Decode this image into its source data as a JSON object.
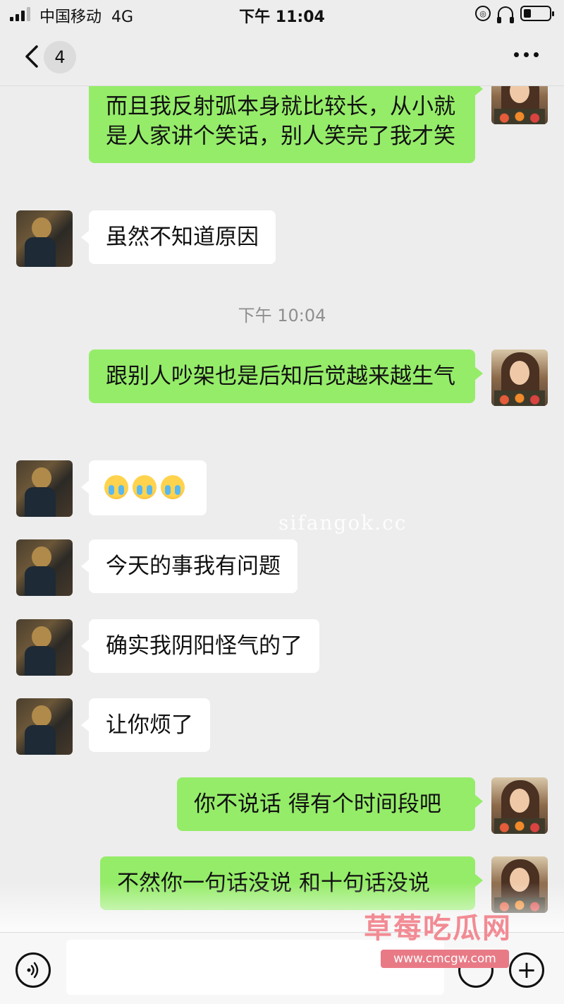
{
  "status_bar": {
    "carrier": "中国移动",
    "network": "4G",
    "time": "下午 11:04",
    "battery_level": 0.3
  },
  "nav": {
    "unread_count": "4",
    "back_icon": "chevron-left-icon",
    "more_icon": "more-horizontal-icon"
  },
  "messages": [
    {
      "side": "out",
      "text": "而且我反射弧本身就比较长，从小就是人家讲个笑话，别人笑完了我才笑"
    },
    {
      "side": "in",
      "text": "虽然不知道原因"
    },
    {
      "side": "time",
      "text": "下午 10:04"
    },
    {
      "side": "out",
      "text": "跟别人吵架也是后知后觉越来越生气"
    },
    {
      "side": "in",
      "text": "",
      "emoji": [
        "loudly-crying-emoji",
        "loudly-crying-emoji",
        "loudly-crying-emoji"
      ]
    },
    {
      "side": "in",
      "text": "今天的事我有问题"
    },
    {
      "side": "in",
      "text": "确实我阴阳怪气的了"
    },
    {
      "side": "in",
      "text": "让你烦了"
    },
    {
      "side": "out",
      "text": "你不说话 得有个时间段吧"
    },
    {
      "side": "out",
      "text": "不然你一句话没说 和十句话没说"
    }
  ],
  "watermarks": {
    "center": "sifangok.cc",
    "logo": "草莓吃瓜网",
    "url": "www.cmcgw.com"
  },
  "input_bar": {
    "voice_icon": "voice-icon",
    "emoji_icon": "emoji-icon",
    "plus_icon": "plus-icon"
  },
  "colors": {
    "outgoing_bubble": "#95ec69",
    "incoming_bubble": "#ffffff",
    "background": "#ededed"
  }
}
